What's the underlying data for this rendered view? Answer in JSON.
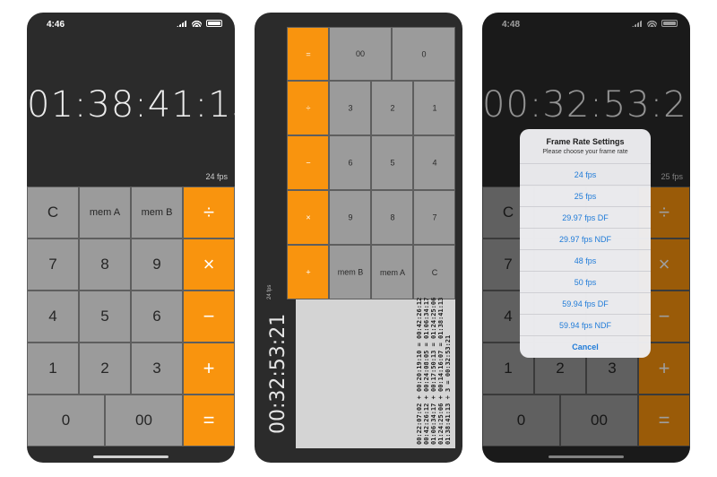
{
  "phone1": {
    "time": "4:46",
    "display": "01:38:41:13",
    "fps": "24 fps",
    "keys": {
      "clear": "C",
      "memA": "mem A",
      "memB": "mem B",
      "divide": "÷",
      "k7": "7",
      "k8": "8",
      "k9": "9",
      "multiply": "×",
      "k4": "4",
      "k5": "5",
      "k6": "6",
      "minus": "−",
      "k1": "1",
      "k2": "2",
      "k3": "3",
      "plus": "+",
      "k0": "0",
      "k00": "00",
      "equals": "="
    }
  },
  "phone2": {
    "display": "00:32:53:21",
    "fps_label": "24 fps",
    "keys": {
      "plus": "+",
      "multiply": "×",
      "minus": "−",
      "divide": "÷",
      "equals": "=",
      "memB": "mem B",
      "k9": "9",
      "k6": "6",
      "k3": "3",
      "k00": "00",
      "memA": "mem A",
      "k8": "8",
      "k5": "5",
      "k2": "2",
      "k0": "0",
      "clear": "C",
      "k7": "7",
      "k4": "4",
      "k1": "1"
    },
    "tape": [
      "00:22:07:02 + 00:20:19:10 = 00:42:26:12",
      "00:42:26:12 + 00:24:08:05 = 01:06:34:17",
      "01:06:34:17 + 00:17:50:13 = 01:24:25:06",
      "01:24:25:06 + 00:14:16:07 = 01:38:41:13",
      "01:38:41:13 ÷ 3 = 00:32:53:21"
    ]
  },
  "phone3": {
    "time": "4:48",
    "display": "00:32:53:21",
    "fps": "25 fps",
    "keys": {
      "clear": "C",
      "divide": "÷",
      "k7": "7",
      "multiply": "×",
      "k4": "4",
      "minus": "−",
      "k1": "1",
      "k2": "2",
      "k3": "3",
      "plus": "+",
      "k0": "0",
      "k00": "00",
      "equals": "="
    },
    "modal": {
      "title": "Frame Rate Settings",
      "subtitle": "Please choose your frame rate",
      "options": [
        "24 fps",
        "25 fps",
        "29.97 fps DF",
        "29.97 fps NDF",
        "48 fps",
        "50 fps",
        "59.94 fps DF",
        "59.94 fps NDF"
      ],
      "cancel": "Cancel"
    }
  },
  "colors": {
    "accent": "#f9940e",
    "key": "#9b9b9b",
    "background": "#2b2b2b",
    "link": "#1f7bd8"
  }
}
